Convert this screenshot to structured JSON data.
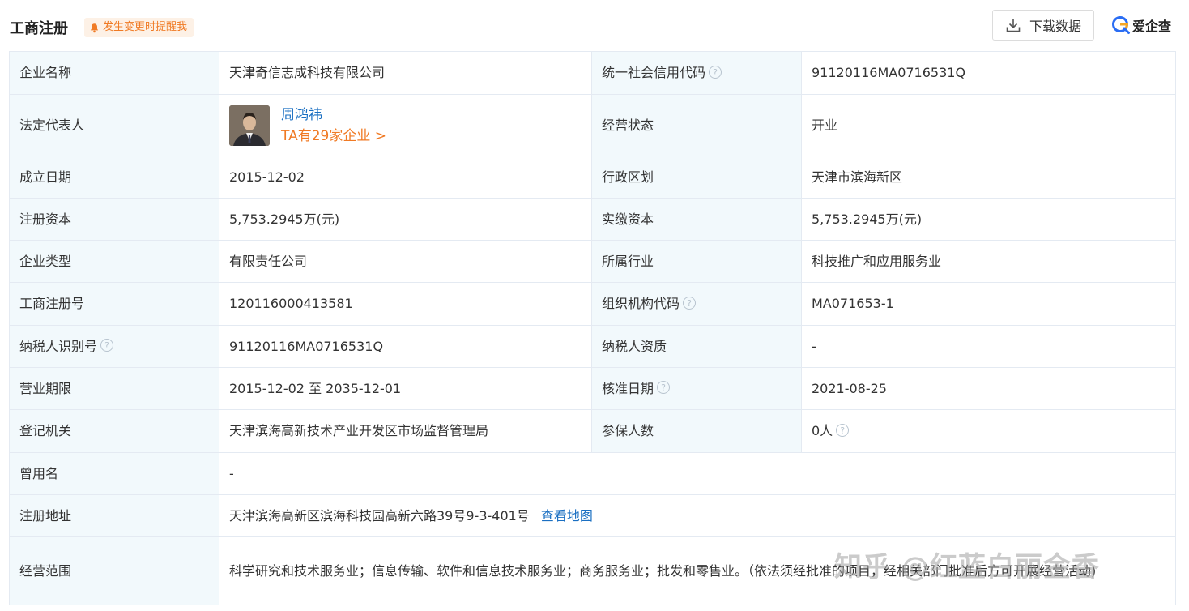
{
  "header": {
    "title": "工商注册",
    "remind_label": "发生变更时提醒我",
    "download_label": "下载数据",
    "brand": "爱企查"
  },
  "rows": {
    "r1": {
      "l1": "企业名称",
      "v1": "天津奇信志成科技有限公司",
      "l2": "统一社会信用代码",
      "v2": "91120116MA0716531Q"
    },
    "r2": {
      "l1": "法定代表人",
      "person_name": "周鸿祎",
      "person_count": "TA有29家企业 >",
      "l2": "经营状态",
      "v2": "开业"
    },
    "r3": {
      "l1": "成立日期",
      "v1": "2015-12-02",
      "l2": "行政区划",
      "v2": "天津市滨海新区"
    },
    "r4": {
      "l1": "注册资本",
      "v1": "5,753.2945万(元)",
      "l2": "实缴资本",
      "v2": "5,753.2945万(元)"
    },
    "r5": {
      "l1": "企业类型",
      "v1": "有限责任公司",
      "l2": "所属行业",
      "v2": "科技推广和应用服务业"
    },
    "r6": {
      "l1": "工商注册号",
      "v1": "120116000413581",
      "l2": "组织机构代码",
      "v2": "MA071653-1"
    },
    "r7": {
      "l1": "纳税人识别号",
      "v1": "91120116MA0716531Q",
      "l2": "纳税人资质",
      "v2": "-"
    },
    "r8": {
      "l1": "营业期限",
      "v1": "2015-12-02 至 2035-12-01",
      "l2": "核准日期",
      "v2": "2021-08-25"
    },
    "r9": {
      "l1": "登记机关",
      "v1": "天津滨海高新技术产业开发区市场监督管理局",
      "l2": "参保人数",
      "v2": "0人"
    },
    "r10": {
      "l1": "曾用名",
      "v1": "-"
    },
    "r11": {
      "l1": "注册地址",
      "v1": "天津滨海高新区滨海科技园高新六路39号9-3-401号",
      "link": "查看地图"
    },
    "r12": {
      "l1": "经营范围",
      "v1": "科学研究和技术服务业；信息传输、软件和信息技术服务业；商务服务业；批发和零售业。（依法须经批准的项目，经相关部门批准后方可开展经营活动)"
    }
  },
  "help_glyph": "?",
  "watermark": "知乎 @红蓝白丽金香",
  "colors": {
    "label_bg": "#f2f9fc",
    "border": "#e4eaf2",
    "link": "#1a6fc2",
    "accent_orange": "#f07a24",
    "remind_bg": "#fdf1e6"
  }
}
